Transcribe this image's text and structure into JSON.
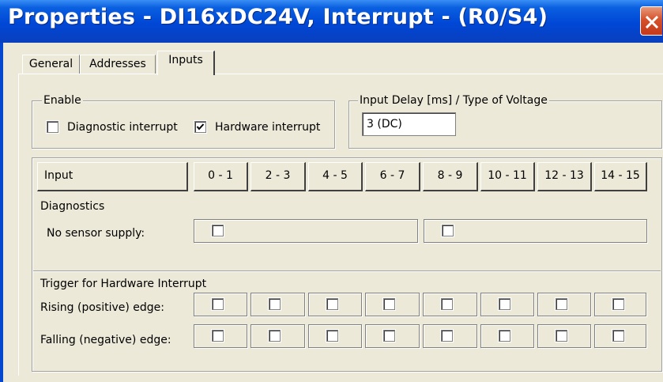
{
  "window": {
    "title": "Properties - DI16xDC24V, Interrupt - (R0/S4)"
  },
  "tabs": [
    {
      "label": "General",
      "active": false
    },
    {
      "label": "Addresses",
      "active": false
    },
    {
      "label": "Inputs",
      "active": true
    }
  ],
  "enable": {
    "title": "Enable",
    "diagnostic_interrupt": {
      "label": "Diagnostic interrupt",
      "checked": false
    },
    "hardware_interrupt": {
      "label": "Hardware interrupt",
      "checked": true
    }
  },
  "input_delay": {
    "title": "Input Delay [ms] / Type of Voltage",
    "value": "3 (DC)"
  },
  "table": {
    "header_label": "Input",
    "columns": [
      "0 - 1",
      "2 - 3",
      "4 - 5",
      "6 - 7",
      "8 - 9",
      "10 - 11",
      "12 - 13",
      "14 - 15"
    ],
    "diagnostics": {
      "section_label": "Diagnostics",
      "no_sensor_supply": {
        "label": "No sensor supply:",
        "values": [
          false,
          false
        ]
      }
    },
    "trigger": {
      "section_label": "Trigger for Hardware Interrupt",
      "rising": {
        "label": "Rising (positive) edge:",
        "values": [
          false,
          false,
          false,
          false,
          false,
          false,
          false,
          false
        ]
      },
      "falling": {
        "label": "Falling (negative) edge:",
        "values": [
          false,
          false,
          false,
          false,
          false,
          false,
          false,
          false
        ]
      }
    }
  },
  "colors": {
    "titlebar": "#0047d6",
    "face": "#ece9d8",
    "close": "#d5512a"
  }
}
